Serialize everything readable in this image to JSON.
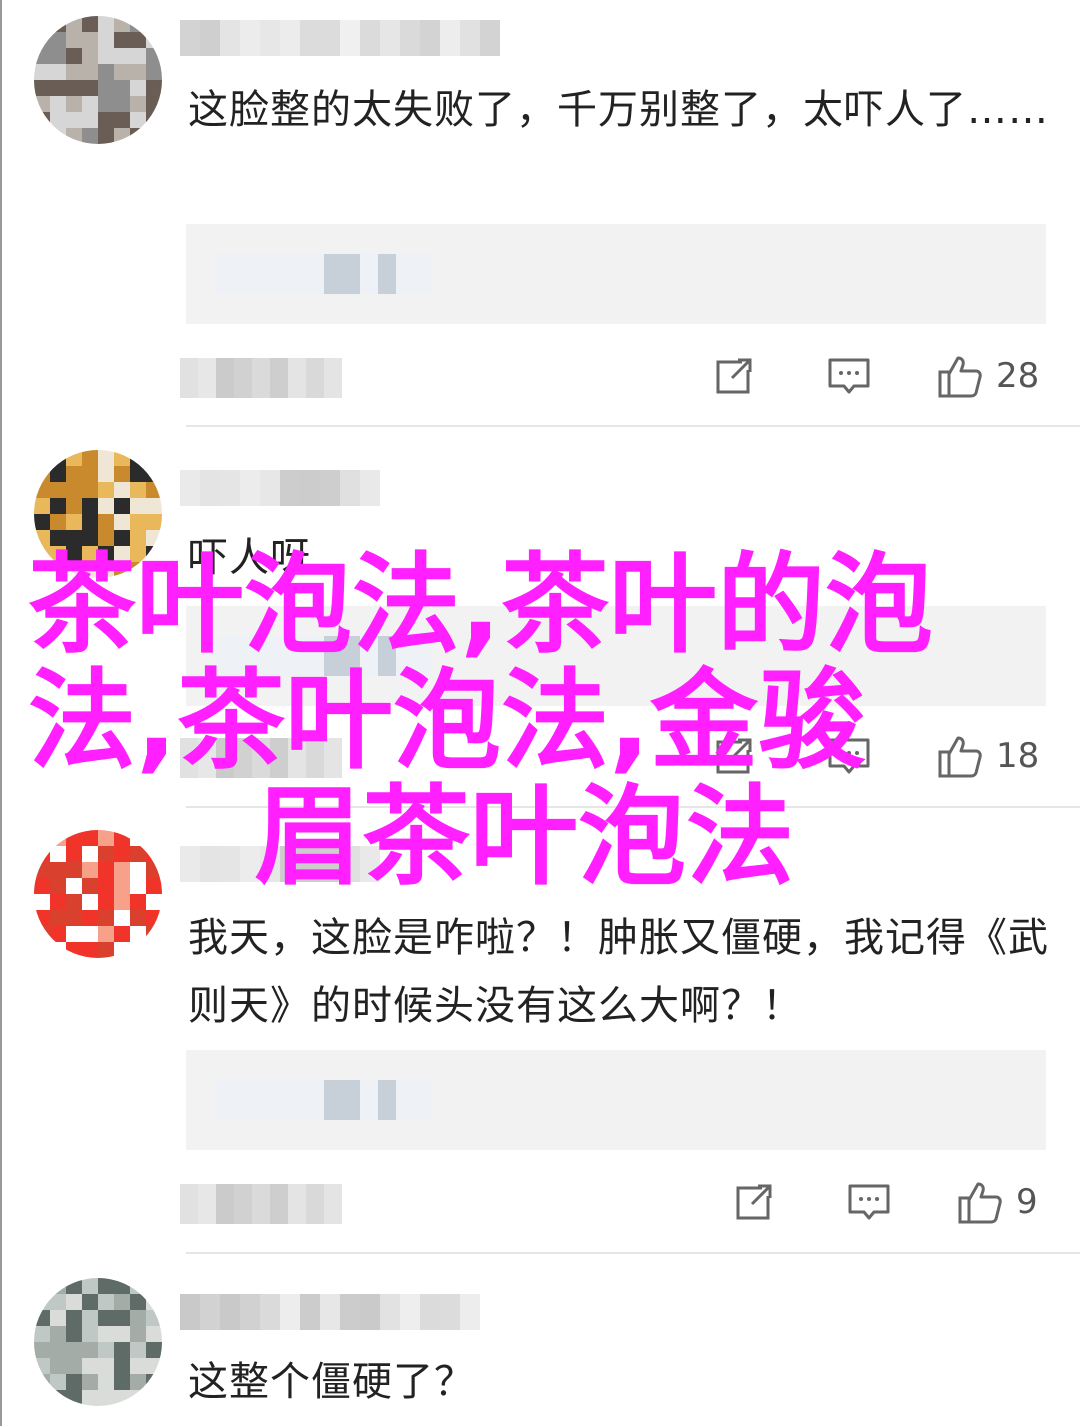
{
  "comments": [
    {
      "text": "这脸整的太失败了，千万别整了，太吓人了……",
      "likes": "28",
      "avatar_colors": [
        "#d6d6d6",
        "#8e8e8e",
        "#6a5d55",
        "#b9b2aa"
      ]
    },
    {
      "text": "吓人呀",
      "likes": "18",
      "avatar_colors": [
        "#e8b85a",
        "#c98a2e",
        "#2b2b2b",
        "#f0e6d6"
      ]
    },
    {
      "text": "我天，这脸是咋啦？！肿胀又僵硬，我记得《武则天》的时候头没有这么大啊？！",
      "likes": "9",
      "avatar_colors": [
        "#f0342a",
        "#d9402e",
        "#f7a08a",
        "#ffffff"
      ]
    },
    {
      "text": "这整个僵硬了？",
      "likes": "",
      "avatar_colors": [
        "#bfc8c4",
        "#5f6b66",
        "#d9dcd8",
        "#a3aca7"
      ]
    }
  ],
  "icons": {
    "share": "share-icon",
    "reply": "comment-icon",
    "like": "thumbs-up-icon"
  },
  "watermark": {
    "line1": "茶叶泡法,茶叶的泡",
    "line2": "法,茶叶泡法,金骏",
    "line3": "眉茶叶泡法",
    "color": "#ff1fff"
  },
  "colors": {
    "text": "#222222",
    "icon": "#666666",
    "reply_bg": "#f2f2f2",
    "blur_light": "#eef2f7",
    "blur_dark": "#c7cfd9"
  }
}
